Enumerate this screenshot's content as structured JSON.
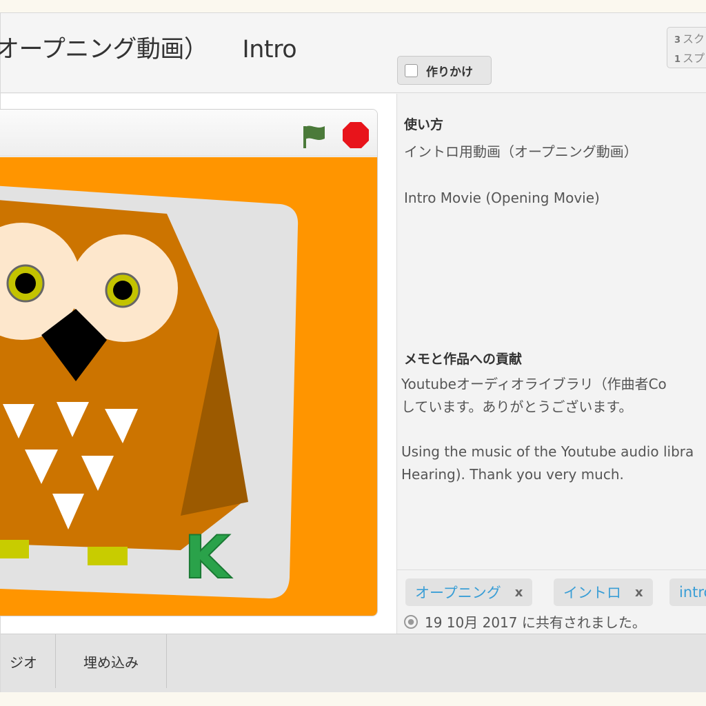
{
  "header": {
    "title_jp": "オープニング動画）",
    "title_en": "Intro",
    "draft_label": "作りかけ",
    "counts": [
      {
        "num": "3",
        "label": "スク"
      },
      {
        "num": "1",
        "label": "スプ"
      }
    ]
  },
  "player": {
    "stage_color": "#ff9500",
    "card_letter": "K"
  },
  "instructions": {
    "heading": "使い方",
    "text_jp": "イントロ用動画（オープニング動画）",
    "text_en": "Intro Movie (Opening Movie)"
  },
  "notes": {
    "heading": "メモと作品への貢献",
    "line1": "Youtubeオーディオライブラリ（作曲者Co",
    "line2": "しています。ありがとうございます。",
    "line3": "Using the music of the Youtube audio libra",
    "line4": "Hearing). Thank you very much."
  },
  "tags": [
    {
      "label": "オープニング",
      "remove": "x"
    },
    {
      "label": "イントロ",
      "remove": "x"
    },
    {
      "label": "intro",
      "remove": ""
    }
  ],
  "shared": "19 10月 2017 に共有されました。",
  "footer": {
    "studio_label": "ジオ",
    "embed_label": "埋め込み"
  },
  "colors": {
    "accent": "#3a9ed6",
    "stop": "#e8141b",
    "flag": "#4b7a3a"
  }
}
